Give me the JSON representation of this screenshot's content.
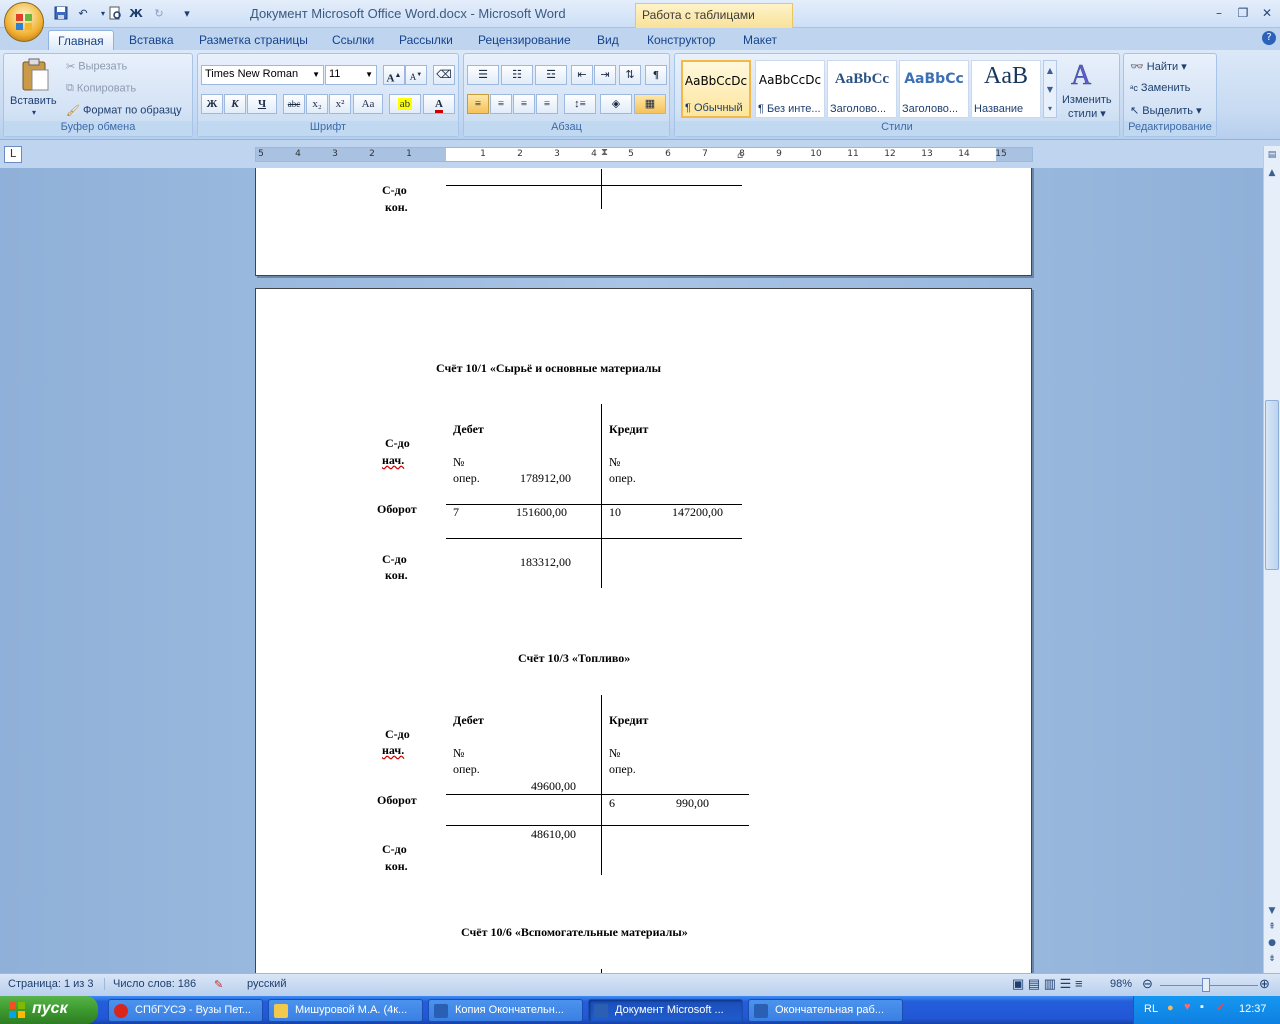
{
  "window": {
    "title": "Документ Microsoft Office Word.docx - Microsoft Word",
    "context_tab_header": "Работа с таблицами"
  },
  "quick_access": {
    "save": "save-icon",
    "undo": "↶",
    "print_preview": "print-preview-icon",
    "bold": "Ж",
    "redo": "↻",
    "customize": "▾"
  },
  "window_controls": {
    "minimize": "–",
    "restore": "❐",
    "close": "✕"
  },
  "tabs": [
    {
      "label": "Главная",
      "active": true
    },
    {
      "label": "Вставка"
    },
    {
      "label": "Разметка страницы"
    },
    {
      "label": "Ссылки"
    },
    {
      "label": "Рассылки"
    },
    {
      "label": "Рецензирование"
    },
    {
      "label": "Вид"
    },
    {
      "label": "Конструктор"
    },
    {
      "label": "Макет"
    }
  ],
  "ribbon": {
    "clipboard": {
      "group_label": "Буфер обмена",
      "paste": "Вставить",
      "cut": "Вырезать",
      "copy": "Копировать",
      "format_painter": "Формат по образцу"
    },
    "font": {
      "group_label": "Шрифт",
      "font_name": "Times New Roman",
      "font_size": "11",
      "bold": "Ж",
      "italic": "К",
      "underline": "Ч",
      "strike": "abc",
      "subscript": "x₂",
      "superscript": "x²",
      "change_case": "Aa",
      "grow": "A",
      "shrink": "A"
    },
    "paragraph": {
      "group_label": "Абзац"
    },
    "styles": {
      "group_label": "Стили",
      "items": [
        {
          "preview": "AaBbCcDc",
          "name": "¶ Обычный"
        },
        {
          "preview": "AaBbCcDc",
          "name": "¶ Без инте..."
        },
        {
          "preview": "AaBbCc",
          "name": "Заголово..."
        },
        {
          "preview": "AaBbCc",
          "name": "Заголово..."
        },
        {
          "preview": "AaB",
          "name": "Название"
        }
      ],
      "change_styles_line1": "Изменить",
      "change_styles_line2": "стили ▾"
    },
    "editing": {
      "group_label": "Редактирование",
      "find": "Найти ▾",
      "replace": "Заменить",
      "select": "Выделить ▾"
    }
  },
  "ruler": {
    "numbers": [
      "5",
      "4",
      "3",
      "2",
      "1",
      "1",
      "2",
      "3",
      "4",
      "5",
      "6",
      "7",
      "8",
      "9",
      "10",
      "11",
      "12",
      "13",
      "14",
      "15"
    ]
  },
  "document": {
    "prev_page": {
      "saldo_end_1": "С-до",
      "saldo_end_2": "кон."
    },
    "account_10_1": {
      "title": "Счёт 10/1 «Сырьё и основные материалы",
      "debit": "Дебет",
      "credit": "Кредит",
      "saldo_start_1": "С-до",
      "saldo_start_2": "нач.",
      "no_debit": "№",
      "oper_debit": "опер.",
      "start_value": "178912,00",
      "no_credit": "№",
      "oper_credit": "опер.",
      "turnover": "Оборот",
      "debit_op": "7",
      "debit_sum": "151600,00",
      "credit_op": "10",
      "credit_sum": "147200,00",
      "saldo_end_1": "С-до",
      "saldo_end_2": "кон.",
      "end_value": "183312,00"
    },
    "account_10_3": {
      "title": "Счёт  10/3 «Топливо»",
      "debit": "Дебет",
      "credit": "Кредит",
      "saldo_start_1": "С-до",
      "saldo_start_2": "нач.",
      "no_debit": "№",
      "oper_debit": "опер.",
      "no_credit": "№",
      "oper_credit": "опер.",
      "start_value": "49600,00",
      "turnover": "Оборот",
      "credit_op": "6",
      "credit_sum": "990,00",
      "end_value": "48610,00",
      "saldo_end_1": "С-до",
      "saldo_end_2": "кон."
    },
    "account_10_6": {
      "title": "Счёт 10/6 «Вспомогательные  материалы»"
    }
  },
  "status_bar": {
    "page": "Страница: 1 из 3",
    "words": "Число слов: 186",
    "language": "русский",
    "zoom": "98%"
  },
  "taskbar": {
    "start": "пуск",
    "items": [
      {
        "label": "СПбГУСЭ - Вузы Пет...",
        "icon_color": "#d8261c"
      },
      {
        "label": "Мишуровой М.А. (4к...",
        "icon_color": "#f2c94c"
      },
      {
        "label": "Копия Окончательн...",
        "icon_color": "#2b5fb3"
      },
      {
        "label": "Документ Microsoft ...",
        "icon_color": "#2b5fb3",
        "active": true
      },
      {
        "label": "Окончательная раб...",
        "icon_color": "#2b5fb3"
      }
    ],
    "lang": "RL",
    "clock": "12:37"
  }
}
